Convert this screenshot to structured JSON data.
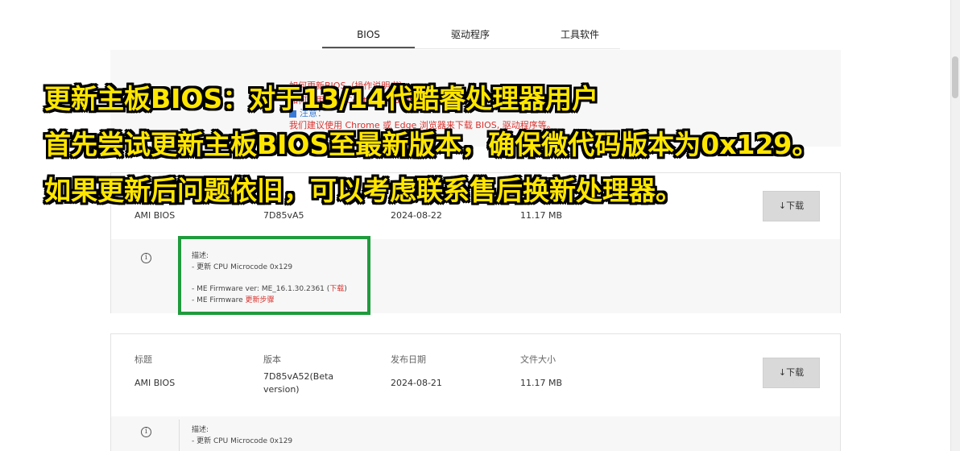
{
  "tabs": [
    {
      "label": "BIOS",
      "active": true
    },
    {
      "label": "驱动程序",
      "active": false
    },
    {
      "label": "工具软件",
      "active": false
    }
  ],
  "notice": {
    "line1": "如何更新BIOS（操作说明书）",
    "line2": "如何使用 MSI Center更新BIOS",
    "line3": "注意：",
    "line4": "我们建议使用 Chrome 或 Edge 浏览器来下载 BIOS, 驱动程序等。"
  },
  "overlay": {
    "line1": "更新主板BIOS：对于13/14代酷睿处理器用户",
    "line2": "首先尝试更新主板BIOS至最新版本，确保微代码版本为0x129。",
    "line3": "如果更新后问题依旧，可以考虑联系售后换新处理器。"
  },
  "card1": {
    "title": "AMI BIOS",
    "version": "7D85vA5",
    "date": "2024-08-22",
    "size": "11.17 MB",
    "download_label": "↓下载",
    "desc_heading": "描述:",
    "desc_line1": "- 更新 CPU Microcode 0x129",
    "desc_line2_prefix": "- ME Firmware ver: ME_16.1.30.2361 (",
    "desc_line2_link": "下载",
    "desc_line2_suffix": ")",
    "desc_line3_prefix": "- ME Firmware ",
    "desc_line3_link": "更新步骤"
  },
  "card2": {
    "headers": {
      "title": "标题",
      "version": "版本",
      "date": "发布日期",
      "size": "文件大小"
    },
    "title": "AMI BIOS",
    "version_line1": "7D85vA52(Beta",
    "version_line2": "version)",
    "date": "2024-08-21",
    "size": "11.17 MB",
    "download_label": "↓下载",
    "desc_heading": "描述:",
    "desc_line1": "- 更新 CPU Microcode 0x129"
  },
  "colors": {
    "highlight_box": "#1f9b3c",
    "overlay_text": "#ffe600",
    "link_red": "#d9332f"
  }
}
